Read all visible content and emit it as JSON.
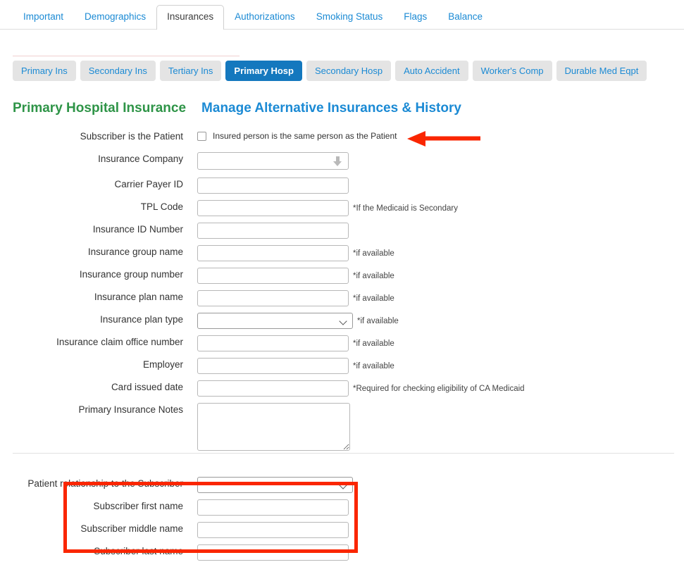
{
  "main_tabs": [
    {
      "label": "Important",
      "active": false
    },
    {
      "label": "Demographics",
      "active": false
    },
    {
      "label": "Insurances",
      "active": true
    },
    {
      "label": "Authorizations",
      "active": false
    },
    {
      "label": "Smoking Status",
      "active": false
    },
    {
      "label": "Flags",
      "active": false
    },
    {
      "label": "Balance",
      "active": false
    }
  ],
  "sub_tabs": [
    {
      "label": "Primary Ins",
      "active": false
    },
    {
      "label": "Secondary Ins",
      "active": false
    },
    {
      "label": "Tertiary Ins",
      "active": false
    },
    {
      "label": "Primary Hosp",
      "active": true
    },
    {
      "label": "Secondary Hosp",
      "active": false
    },
    {
      "label": "Auto Accident",
      "active": false
    },
    {
      "label": "Worker's Comp",
      "active": false
    },
    {
      "label": "Durable Med Eqpt",
      "active": false
    }
  ],
  "headings": {
    "section_title": "Primary Hospital Insurance",
    "manage_link": "Manage Alternative Insurances & History"
  },
  "form": {
    "subscriber_is_patient": {
      "label": "Subscriber is the Patient",
      "checkbox_text": "Insured person is the same person as the Patient",
      "checked": false
    },
    "insurance_company": {
      "label": "Insurance Company",
      "value": "",
      "hint": ""
    },
    "carrier_payer_id": {
      "label": "Carrier Payer ID",
      "value": "",
      "hint": ""
    },
    "tpl_code": {
      "label": "TPL Code",
      "value": "",
      "hint": "*If the Medicaid is Secondary"
    },
    "insurance_id_number": {
      "label": "Insurance ID Number",
      "value": "",
      "hint": ""
    },
    "insurance_group_name": {
      "label": "Insurance group name",
      "value": "",
      "hint": "*if available"
    },
    "insurance_group_number": {
      "label": "Insurance group number",
      "value": "",
      "hint": "*if available"
    },
    "insurance_plan_name": {
      "label": "Insurance plan name",
      "value": "",
      "hint": "*if available"
    },
    "insurance_plan_type": {
      "label": "Insurance plan type",
      "value": "",
      "hint": "*if available"
    },
    "insurance_claim_office_number": {
      "label": "Insurance claim office number",
      "value": "",
      "hint": "*if available"
    },
    "employer": {
      "label": "Employer",
      "value": "",
      "hint": "*if available"
    },
    "card_issued_date": {
      "label": "Card issued date",
      "value": "",
      "hint": "*Required for checking eligibility of CA Medicaid"
    },
    "primary_insurance_notes": {
      "label": "Primary Insurance Notes",
      "value": ""
    },
    "patient_relationship": {
      "label": "Patient relationship to the Subscriber",
      "value": ""
    },
    "subscriber_first_name": {
      "label": "Subscriber first name",
      "value": ""
    },
    "subscriber_middle_name": {
      "label": "Subscriber middle name",
      "value": ""
    },
    "subscriber_last_name": {
      "label": "Subscriber last name",
      "value": ""
    }
  },
  "annotations": {
    "arrow_color": "#fa2600",
    "box_color": "#fa2600",
    "arrow_target": "Insured person is the same person as the Patient",
    "box_target": "Subscriber name fields"
  },
  "colors": {
    "active_subtab_bg": "#1478be",
    "inactive_subtab_bg": "#e4e4e4",
    "link_blue": "#1b8ad4",
    "heading_green": "#2e9447",
    "annotation_red": "#fa2600"
  }
}
